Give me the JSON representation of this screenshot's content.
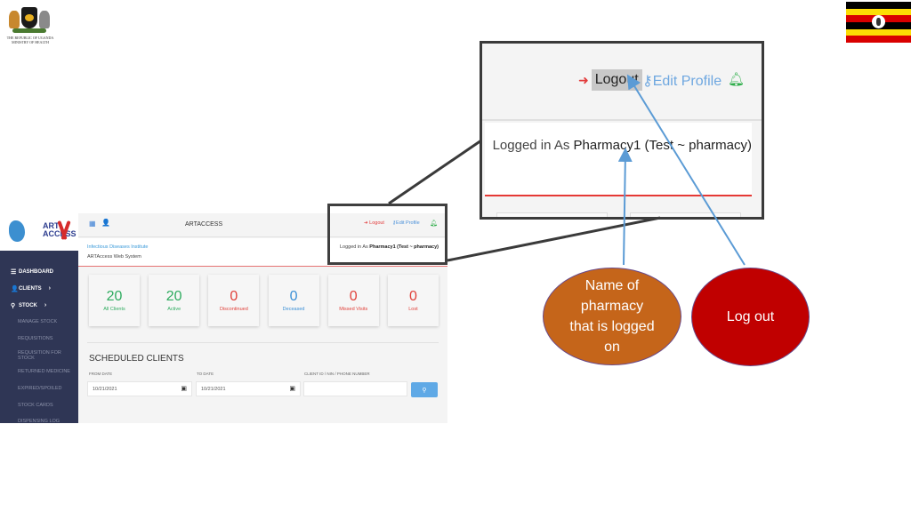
{
  "slide": {
    "coat_of_arms_caption": "THE REPUBLIC OF UGANDA MINISTRY OF HEALTH",
    "flag_colors": [
      "#000000",
      "#fcdc04",
      "#d90000",
      "#000000",
      "#fcdc04",
      "#d90000"
    ]
  },
  "app": {
    "logo_text": "ART ACCESS",
    "title": "ARTACCESS",
    "header": {
      "logout_label": "Logout",
      "edit_profile_label": "Edit Profile"
    },
    "info": {
      "organization": "Infectious Diseases Institute",
      "system_name": "ARTAccess Web System",
      "logged_in_prefix": "Logged in As",
      "logged_in_user": "Pharmacy1 (Test ~ pharmacy)"
    },
    "sidebar": {
      "items": [
        {
          "label": "DASHBOARD",
          "icon": "list-icon"
        },
        {
          "label": "CLIENTS",
          "icon": "user-icon",
          "chevron": "›"
        },
        {
          "label": "STOCK",
          "icon": "binoculars-icon",
          "chevron": "›"
        }
      ],
      "sub_items": [
        "MANAGE STOCK",
        "REQUISITIONS",
        "REQUISITION FOR STOCK",
        "RETURNED MEDICINE",
        "EXPIRED/SPOILED",
        "STOCK CARDS",
        "DISPENSING LOG"
      ]
    },
    "stats": [
      {
        "value": "20",
        "label": "All Clients",
        "color": "#2eab5f"
      },
      {
        "value": "20",
        "label": "Active",
        "color": "#2eab5f"
      },
      {
        "value": "0",
        "label": "Discontinued",
        "color": "#e0413a"
      },
      {
        "value": "0",
        "label": "Deceased",
        "color": "#3a8fd6"
      },
      {
        "value": "0",
        "label": "Missed Visits",
        "color": "#e0413a"
      },
      {
        "value": "0",
        "label": "Lost",
        "color": "#e0413a"
      }
    ],
    "scheduled": {
      "title": "SCHEDULED CLIENTS",
      "from_label": "FROM DATE",
      "from_value": "10/21/2021",
      "to_label": "TO DATE",
      "to_value": "10/21/2021",
      "client_label": "CLIENT ID / NIN / PHONE NUMBER",
      "client_value": ""
    }
  },
  "callout": {
    "logout_label": "Logout",
    "edit_profile_label": "Edit Profile",
    "logged_in_prefix": "Logged in As",
    "logged_in_user": "Pharmacy1 (Test ~ pharmacy)"
  },
  "annotations": {
    "pharmacy_name": "Name of pharmacy that is logged on",
    "logout": "Log out"
  },
  "colors": {
    "sidebar_bg": "#2f3655",
    "annotation_orange": "#c5651a",
    "annotation_red": "#c00000",
    "arrow_blue": "#5b9bd5"
  }
}
